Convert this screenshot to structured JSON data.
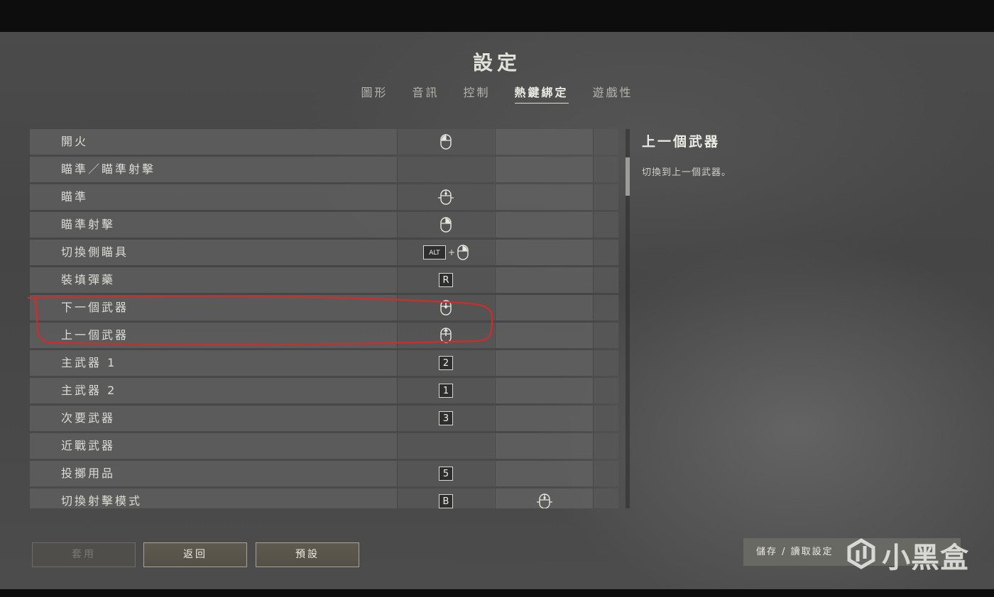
{
  "title": "設定",
  "tabs": [
    {
      "label": "圖形",
      "active": false
    },
    {
      "label": "音訊",
      "active": false
    },
    {
      "label": "控制",
      "active": false
    },
    {
      "label": "熱鍵綁定",
      "active": true
    },
    {
      "label": "遊戲性",
      "active": false
    }
  ],
  "bindings": [
    {
      "label": "開火",
      "primary": "mouse-left-button-icon",
      "secondary": ""
    },
    {
      "label": "瞄準／瞄準射擊",
      "primary": "",
      "secondary": ""
    },
    {
      "label": "瞄準",
      "primary": "mouse-right-button-hold-icon",
      "secondary": ""
    },
    {
      "label": "瞄準射擊",
      "primary": "mouse-right-button-icon",
      "secondary": ""
    },
    {
      "label": "切換側瞄具",
      "primary": "ALT + mouse-right-button-icon",
      "alt_key": "ALT",
      "plus": "+",
      "secondary": ""
    },
    {
      "label": "裝填彈藥",
      "primary": "R",
      "secondary": ""
    },
    {
      "label": "下一個武器",
      "primary": "mouse-wheel-down-icon",
      "secondary": ""
    },
    {
      "label": "上一個武器",
      "primary": "mouse-wheel-up-icon",
      "secondary": ""
    },
    {
      "label": "主武器 1",
      "primary": "2",
      "secondary": ""
    },
    {
      "label": "主武器 2",
      "primary": "1",
      "secondary": ""
    },
    {
      "label": "次要武器",
      "primary": "3",
      "secondary": ""
    },
    {
      "label": "近戰武器",
      "primary": "",
      "secondary": ""
    },
    {
      "label": "投擲用品",
      "primary": "5",
      "secondary": ""
    },
    {
      "label": "切換射擊模式",
      "primary": "B",
      "secondary": "mouse-right-button-hold-icon"
    }
  ],
  "description": {
    "title": "上一個武器",
    "text": "切換到上一個武器。"
  },
  "buttons": {
    "apply": "套用",
    "back": "返回",
    "default": "預設",
    "save_load": "儲存 / 讀取設定"
  },
  "watermark": "小黑盒",
  "colors": {
    "annotation": "#d42a2a",
    "accent_button_border": "#a8a396"
  }
}
